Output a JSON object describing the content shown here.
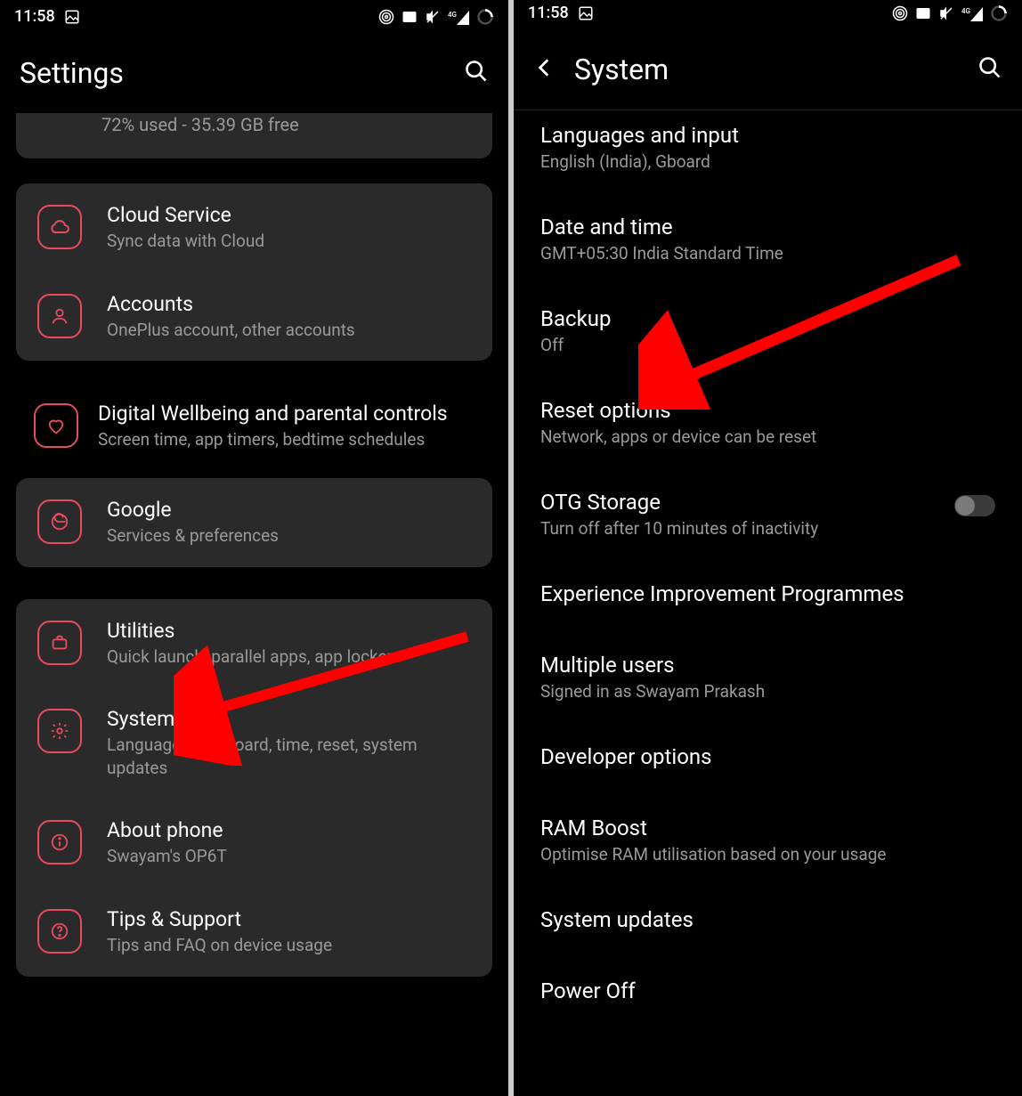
{
  "left": {
    "status": {
      "time": "11:58"
    },
    "header": {
      "title": "Settings"
    },
    "partial": {
      "sub": "72% used - 35.39 GB free"
    },
    "group1": [
      {
        "icon": "cloud-icon",
        "title": "Cloud Service",
        "sub": "Sync data with Cloud"
      },
      {
        "icon": "user-icon",
        "title": "Accounts",
        "sub": "OnePlus account, other accounts"
      }
    ],
    "flat": [
      {
        "icon": "heart-icon",
        "title": "Digital Wellbeing and parental controls",
        "sub": "Screen time, app timers, bedtime schedules"
      }
    ],
    "group2": [
      {
        "icon": "google-icon",
        "title": "Google",
        "sub": "Services & preferences"
      }
    ],
    "group3": [
      {
        "icon": "briefcase-icon",
        "title": "Utilities",
        "sub": "Quick launch, parallel apps, app locker"
      },
      {
        "icon": "gear-icon",
        "title": "System",
        "sub": "Language & keyboard, time, reset, system updates"
      },
      {
        "icon": "info-icon",
        "title": "About phone",
        "sub": "Swayam's OP6T"
      },
      {
        "icon": "help-icon",
        "title": "Tips & Support",
        "sub": "Tips and FAQ on device usage"
      }
    ]
  },
  "right": {
    "status": {
      "time": "11:58"
    },
    "header": {
      "title": "System"
    },
    "rows": [
      {
        "title": "Languages and input",
        "sub": "English (India), Gboard"
      },
      {
        "title": "Date and time",
        "sub": "GMT+05:30 India Standard Time"
      },
      {
        "title": "Backup",
        "sub": "Off"
      },
      {
        "title": "Reset options",
        "sub": "Network, apps or device can be reset"
      },
      {
        "title": "OTG Storage",
        "sub": "Turn off after 10 minutes of inactivity",
        "toggle": false
      },
      {
        "title": "Experience Improvement Programmes",
        "sub": ""
      },
      {
        "title": "Multiple users",
        "sub": "Signed in as Swayam Prakash"
      },
      {
        "title": "Developer options",
        "sub": ""
      },
      {
        "title": "RAM Boost",
        "sub": "Optimise RAM utilisation based on your usage"
      },
      {
        "title": "System updates",
        "sub": ""
      },
      {
        "title": "Power Off",
        "sub": ""
      }
    ]
  }
}
